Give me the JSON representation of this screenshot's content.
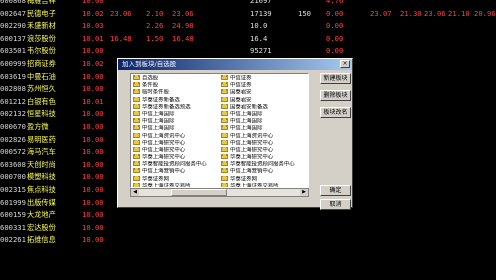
{
  "stocks": [
    {
      "code": "600868",
      "name": "梅雁吉祥",
      "chg": "10.00",
      "price": "",
      "diff": "",
      "bid": "",
      "ask": "",
      "vol": "21697",
      "cur": "",
      "sp": "4.76",
      "turn": "",
      "open": "",
      "high": "",
      "low": "",
      "close": "",
      "dir": "up"
    },
    {
      "code": "002647",
      "name": "民德电子",
      "chg": "10.02",
      "price": "23.06",
      "diff": "2.10",
      "bid": "23.06",
      "ask": "",
      "vol": "17139",
      "cur": "150",
      "sp": "0.00",
      "turn": "23.07",
      "open": "21.30",
      "high": "23.06",
      "low": "21.10",
      "close": "20.96",
      "dir": "up"
    },
    {
      "code": "002290",
      "name": "禾盛新材",
      "chg": "10.03",
      "price": "",
      "diff": "2.26",
      "bid": "24.98",
      "ask": "",
      "vol": "10.0",
      "cur": "",
      "sp": "0.00",
      "turn": "",
      "open": "",
      "high": "",
      "low": "",
      "close": "",
      "dir": "up"
    },
    {
      "code": "600137",
      "name": "浪莎股份",
      "chg": "10.01",
      "price": "16.48",
      "diff": "1.50",
      "bid": "16.48",
      "ask": "",
      "vol": "16.4",
      "cur": "",
      "sp": "0.00",
      "turn": "",
      "open": "",
      "high": "",
      "low": "",
      "close": "",
      "dir": "up"
    },
    {
      "code": "603501",
      "name": "韦尔股份",
      "chg": "10.00",
      "price": "",
      "diff": "",
      "bid": "",
      "ask": "",
      "vol": "95271",
      "cur": "",
      "sp": "0.00",
      "turn": "",
      "open": "",
      "high": "",
      "low": "",
      "close": "",
      "dir": "up"
    },
    {
      "code": "600999",
      "name": "招商证券",
      "chg": "10.02",
      "price": "",
      "diff": "",
      "bid": "",
      "ask": "",
      "vol": "",
      "cur": "",
      "sp": "",
      "turn": "",
      "open": "",
      "high": "",
      "low": "",
      "close": "",
      "dir": "up"
    },
    {
      "code": "603619",
      "name": "中曼石油",
      "chg": "10.00",
      "price": "",
      "diff": "",
      "bid": "",
      "ask": "",
      "vol": "",
      "cur": "",
      "sp": "",
      "turn": "",
      "open": "",
      "high": "",
      "low": "",
      "close": "",
      "dir": "up"
    },
    {
      "code": "002808",
      "name": "苏州恒久",
      "chg": "10.00",
      "price": "",
      "diff": "",
      "bid": "",
      "ask": "",
      "vol": "",
      "cur": "",
      "sp": "",
      "turn": "",
      "open": "",
      "high": "",
      "low": "",
      "close": "",
      "dir": "up"
    },
    {
      "code": "601212",
      "name": "白银有色",
      "chg": "10.01",
      "price": "",
      "diff": "",
      "bid": "",
      "ask": "",
      "vol": "",
      "cur": "",
      "sp": "",
      "turn": "",
      "open": "",
      "high": "",
      "low": "",
      "close": "",
      "dir": "up"
    },
    {
      "code": "002132",
      "name": "恒星科技",
      "chg": "10.00",
      "price": "",
      "diff": "",
      "bid": "",
      "ask": "",
      "vol": "",
      "cur": "",
      "sp": "",
      "turn": "",
      "open": "",
      "high": "",
      "low": "",
      "close": "",
      "dir": "up"
    },
    {
      "code": "000670",
      "name": "盈方微",
      "chg": "10.00",
      "price": "",
      "diff": "",
      "bid": "",
      "ask": "",
      "vol": "",
      "cur": "",
      "sp": "",
      "turn": "",
      "open": "",
      "high": "",
      "low": "",
      "close": "",
      "dir": "up"
    },
    {
      "code": "002826",
      "name": "易明医药",
      "chg": "10.00",
      "price": "",
      "diff": "",
      "bid": "",
      "ask": "",
      "vol": "",
      "cur": "",
      "sp": "",
      "turn": "",
      "open": "",
      "high": "",
      "low": "",
      "close": "",
      "dir": "up"
    },
    {
      "code": "000572",
      "name": "海马汽车",
      "chg": "10.00",
      "price": "",
      "diff": "",
      "bid": "",
      "ask": "",
      "vol": "",
      "cur": "",
      "sp": "",
      "turn": "",
      "open": "",
      "high": "",
      "low": "",
      "close": "",
      "dir": "up"
    },
    {
      "code": "603608",
      "name": "天创时尚",
      "chg": "10.00",
      "price": "",
      "diff": "",
      "bid": "",
      "ask": "",
      "vol": "",
      "cur": "",
      "sp": "",
      "turn": "",
      "open": "",
      "high": "",
      "low": "",
      "close": "",
      "dir": "up"
    },
    {
      "code": "000700",
      "name": "模塑科技",
      "chg": "10.00",
      "price": "",
      "diff": "",
      "bid": "",
      "ask": "",
      "vol": "",
      "cur": "",
      "sp": "",
      "turn": "",
      "open": "",
      "high": "",
      "low": "",
      "close": "",
      "dir": "up"
    },
    {
      "code": "002315",
      "name": "焦点科技",
      "chg": "10.00",
      "price": "",
      "diff": "",
      "bid": "",
      "ask": "",
      "vol": "",
      "cur": "",
      "sp": "",
      "turn": "",
      "open": "",
      "high": "",
      "low": "",
      "close": "",
      "dir": "up"
    },
    {
      "code": "601999",
      "name": "出版传媒",
      "chg": "10.00",
      "price": "",
      "diff": "",
      "bid": "",
      "ask": "",
      "vol": "",
      "cur": "",
      "sp": "",
      "turn": "",
      "open": "",
      "high": "",
      "low": "",
      "close": "",
      "dir": "up"
    },
    {
      "code": "600159",
      "name": "大龙地产",
      "chg": "10.00",
      "price": "",
      "diff": "",
      "bid": "",
      "ask": "",
      "vol": "",
      "cur": "",
      "sp": "",
      "turn": "",
      "open": "",
      "high": "",
      "low": "",
      "close": "",
      "dir": "up"
    },
    {
      "code": "600331",
      "name": "宏达股份",
      "chg": "10.00",
      "price": "",
      "diff": "",
      "bid": "",
      "ask": "",
      "vol": "",
      "cur": "",
      "sp": "",
      "turn": "",
      "open": "",
      "high": "",
      "low": "",
      "close": "",
      "dir": "up"
    },
    {
      "code": "002261",
      "name": "拓维信息",
      "chg": "10.00",
      "price": "",
      "diff": "",
      "bid": "",
      "ask": "",
      "vol": "",
      "cur": "",
      "sp": "",
      "turn": "",
      "open": "",
      "high": "",
      "low": "",
      "close": "",
      "dir": "up"
    }
  ],
  "dialog": {
    "title": "加入到板块/自选股",
    "close_label": "×",
    "col_a": [
      "自选股",
      "条件股",
      "临时条件股",
      "华泰证券新备选",
      "华泰证券新备选预选",
      "中信上海国际",
      "中信上海国际",
      "中信上海国际",
      "中信上海资讯中心",
      "中信上海研究中心",
      "中信上海研究中心",
      "华泰上海研究中心",
      "华泰智能投资顾问服务中心",
      "中信上海营销中心",
      "华泰证券网",
      "华泰上海证券交易所"
    ],
    "col_b": [
      "中信证券",
      "中信证券",
      "国泰君安",
      "国泰君安",
      "国泰君安新备选",
      "中信上海国际",
      "中信上海国际",
      "中信上海国际",
      "中信上海资讯中心",
      "中信上海研究中心",
      "中信上海研究中心",
      "华泰上海研究中心",
      "华泰智能投资顾问服务中心",
      "中信上海营销中心",
      "华泰证券网",
      "华泰上海证券交易所"
    ],
    "btn_new": "新建板块",
    "btn_delete": "删除板块",
    "btn_rename": "板块改名",
    "btn_ok": "确定",
    "btn_cancel": "取消"
  }
}
